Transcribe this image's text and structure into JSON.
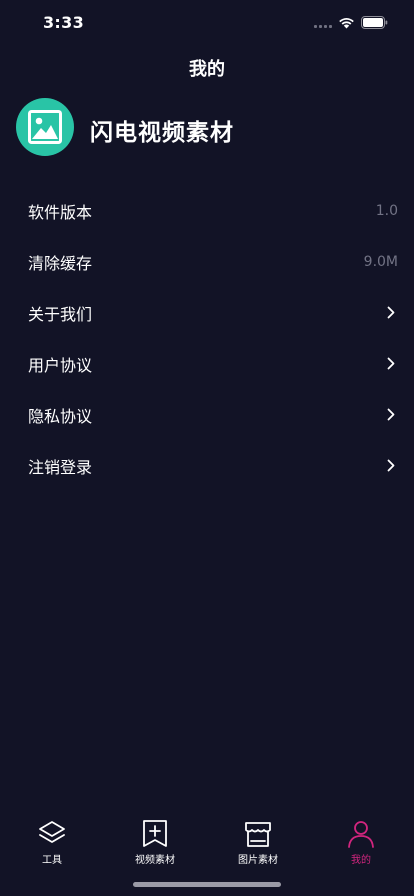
{
  "status_bar": {
    "time": "3:33"
  },
  "nav": {
    "title": "我的"
  },
  "profile": {
    "name": "闪电视频素材",
    "avatar_icon": "image-icon",
    "avatar_color": "#29c4a6"
  },
  "menu": {
    "items": [
      {
        "label": "软件版本",
        "value": "1.0"
      },
      {
        "label": "清除缓存",
        "value": "9.0M"
      },
      {
        "label": "关于我们",
        "icon": "chevron-right-icon"
      },
      {
        "label": "用户协议",
        "icon": "chevron-right-icon"
      },
      {
        "label": "隐私协议",
        "icon": "chevron-right-icon"
      },
      {
        "label": "注销登录",
        "icon": "chevron-right-icon"
      }
    ]
  },
  "tab_bar": {
    "active_color": "#d1257e",
    "items": [
      {
        "label": "工具",
        "icon": "layers-icon"
      },
      {
        "label": "视频素材",
        "icon": "add-bookmark-icon"
      },
      {
        "label": "图片素材",
        "icon": "store-icon"
      },
      {
        "label": "我的",
        "icon": "user-icon",
        "active": true
      }
    ]
  }
}
